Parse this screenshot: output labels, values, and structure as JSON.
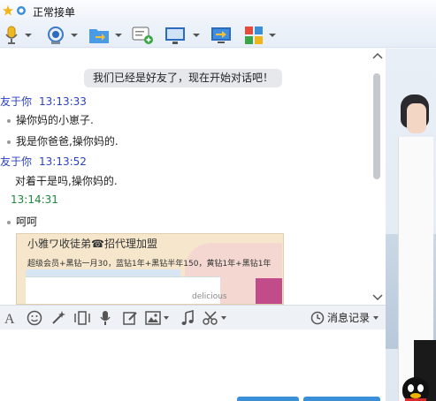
{
  "status": {
    "text": "正常接单"
  },
  "chat": {
    "system_message": "我们已经是好友了，现在开始对话吧！",
    "entries": [
      {
        "sender": "友于你",
        "time": "13:13:33"
      },
      {
        "sender": "友于你",
        "time": "13:13:52"
      }
    ],
    "messages": [
      "操你妈的小崽子.",
      "我是你爸爸,操你妈的.",
      "对着干是吗,操你妈的.",
      "呵呵"
    ],
    "green_time": "13:14:31",
    "embedded_screenshot": {
      "title": "小雅ワ收徒弟☎招代理加盟",
      "subtitle": "超级会员+黑钻一月30，蓝钻1年+黑钻半年150，黄钻1年+黑钻1年",
      "logo_text": "delicious"
    }
  },
  "input_toolbar": {
    "history_label": "消息记录"
  }
}
